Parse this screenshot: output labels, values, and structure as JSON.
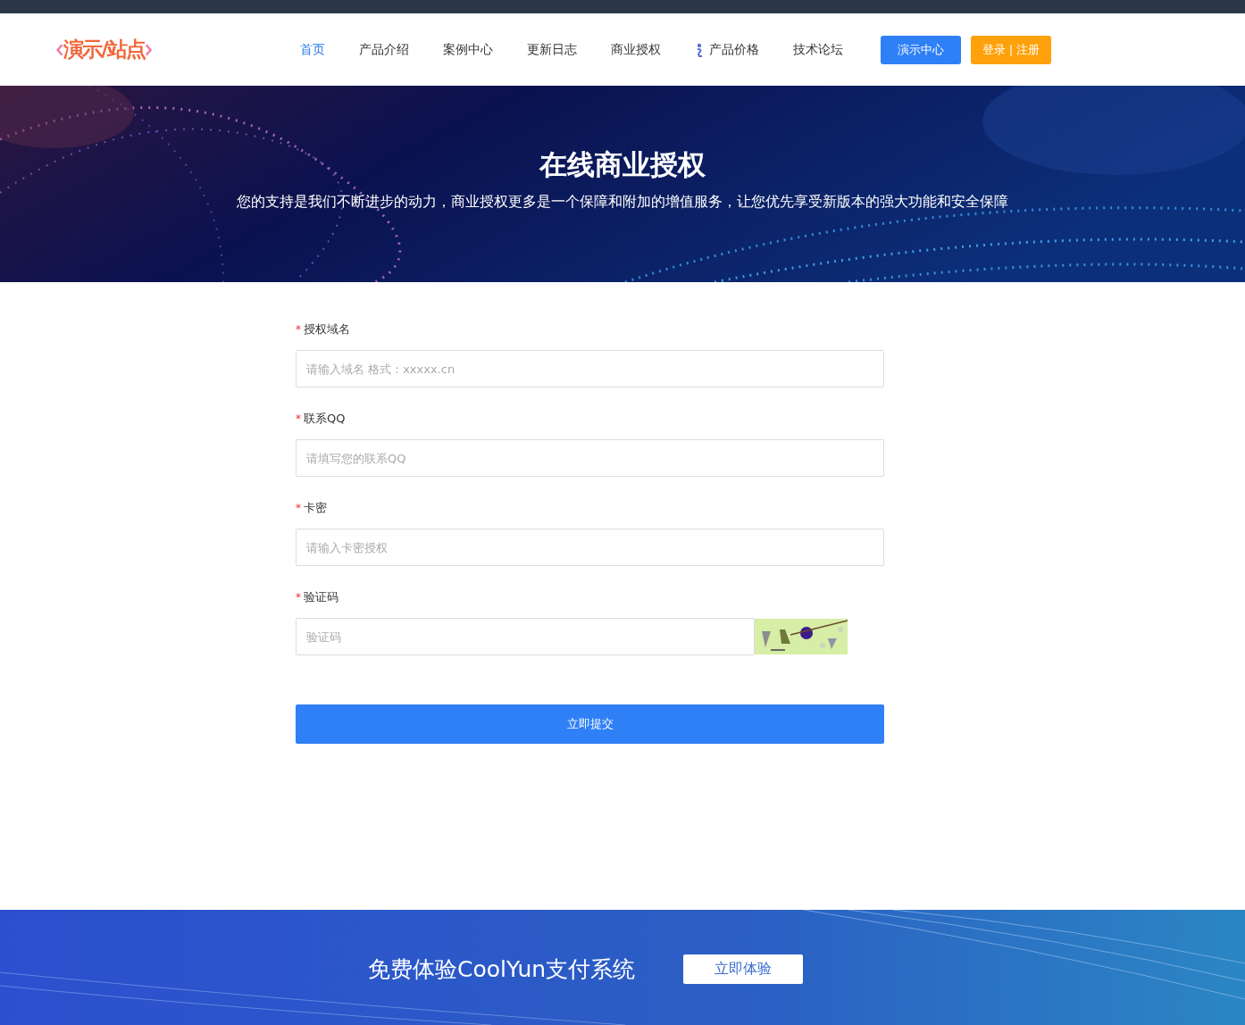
{
  "header": {
    "logo": "演示/站点",
    "nav": [
      {
        "label": "首页",
        "selected": true,
        "kind": "text"
      },
      {
        "label": "产品介绍",
        "selected": false,
        "kind": "text"
      },
      {
        "label": "案例中心",
        "selected": false,
        "kind": "text"
      },
      {
        "label": "更新日志",
        "selected": false,
        "kind": "text"
      },
      {
        "label": "商业授权",
        "selected": false,
        "kind": "text"
      },
      {
        "label": "产品价格",
        "selected": false,
        "kind": "icon"
      },
      {
        "label": "技术论坛",
        "selected": false,
        "kind": "text"
      }
    ],
    "buttons": [
      {
        "label": "演示中心",
        "kind": "primary"
      },
      {
        "label": "登录 | 注册",
        "kind": "warning"
      }
    ]
  },
  "hero": {
    "title": "在线商业授权",
    "subtitle": "您的支持是我们不断进步的动力，商业授权更多是一个保障和附加的增值服务，让您优先享受新版本的强大功能和安全保障"
  },
  "form": {
    "fields": [
      {
        "mark": "*",
        "label": "授权域名",
        "placeholder": "请输入域名 格式：xxxxx.cn",
        "kind": "text"
      },
      {
        "mark": "*",
        "label": "联系QQ",
        "placeholder": "请填写您的联系QQ",
        "kind": "text"
      },
      {
        "mark": "*",
        "label": "卡密",
        "placeholder": "请输入卡密授权",
        "kind": "text"
      },
      {
        "mark": "*",
        "label": "验证码",
        "placeholder": "验证码",
        "kind": "captcha"
      }
    ],
    "submit": "立即提交"
  },
  "banner": {
    "text": "免费体验CoolYun支付系统",
    "button": "立即体验"
  }
}
